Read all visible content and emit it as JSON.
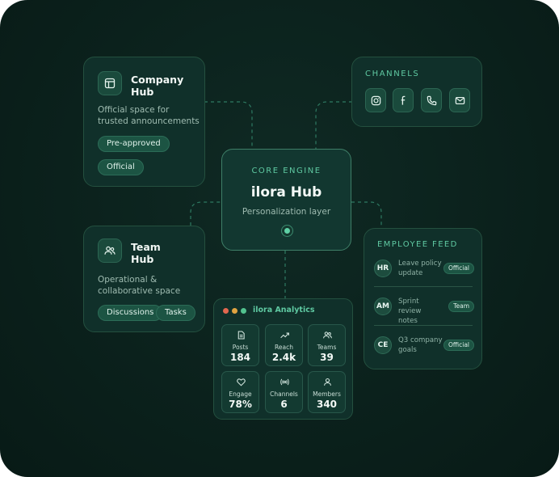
{
  "company_hub": {
    "title_line1": "Company",
    "title_line2": "Hub",
    "desc_line1": "Official space for",
    "desc_line2": "trusted announcements",
    "tags": [
      "Pre-approved",
      "Official"
    ],
    "icon": "layout-icon"
  },
  "channels": {
    "heading": "CHANNELS",
    "icons": [
      "instagram-icon",
      "facebook-icon",
      "phone-icon",
      "mail-icon"
    ]
  },
  "core": {
    "label": "CORE ENGINE",
    "title": "ilora Hub",
    "subtitle": "Personalization layer"
  },
  "team_hub": {
    "title_line1": "Team",
    "title_line2": "Hub",
    "desc_line1": "Operational &",
    "desc_line2": "collaborative space",
    "tags": [
      "Discussions",
      "Tasks"
    ],
    "icon": "users-icon"
  },
  "feed": {
    "heading": "EMPLOYEE FEED",
    "items": [
      {
        "initials": "HR",
        "line1": "Leave policy",
        "line2": "update",
        "badge": "Official"
      },
      {
        "initials": "AM",
        "line1": "Sprint review",
        "line2": "notes",
        "badge": "Team"
      },
      {
        "initials": "CE",
        "line1": "Q3 company",
        "line2": "goals",
        "badge": "Official"
      }
    ]
  },
  "analytics": {
    "title": "ilora Analytics",
    "tiles": [
      {
        "label": "Posts",
        "value": "184",
        "icon": "document-icon"
      },
      {
        "label": "Reach",
        "value": "2.4k",
        "icon": "trend-icon"
      },
      {
        "label": "Teams",
        "value": "39",
        "icon": "team-icon"
      },
      {
        "label": "Engage",
        "value": "78%",
        "icon": "heart-icon"
      },
      {
        "label": "Channels",
        "value": "6",
        "icon": "broadcast-icon"
      },
      {
        "label": "Members",
        "value": "340",
        "icon": "person-icon"
      }
    ]
  },
  "colors": {
    "background": "#0b211c",
    "card": "#10302a",
    "accent": "#5fc9a2",
    "window_dots": [
      "#e2674f",
      "#e0a341",
      "#52c28f"
    ]
  }
}
